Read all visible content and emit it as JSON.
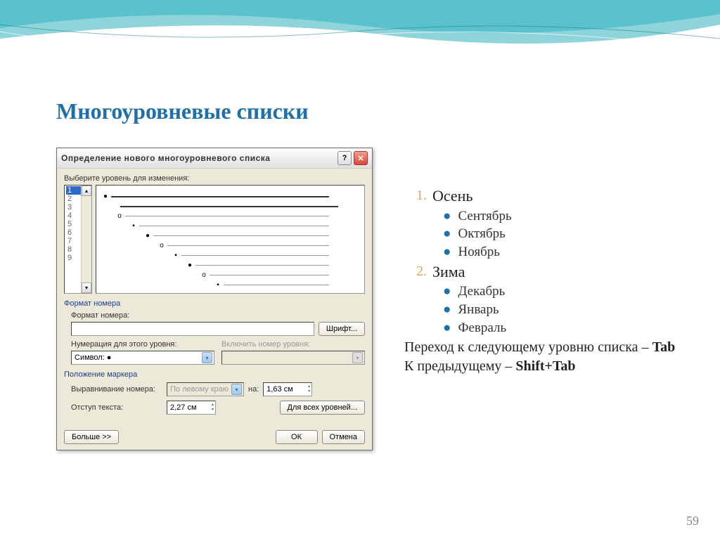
{
  "slide": {
    "title": "Многоуровневые списки",
    "page_number": "59"
  },
  "dialog": {
    "title": "Определение нового многоуровневого списка",
    "level_label": "Выберите уровень для изменения:",
    "levels": [
      "1",
      "2",
      "3",
      "4",
      "5",
      "6",
      "7",
      "8",
      "9"
    ],
    "format_section": "Формат номера",
    "format_label": "Формат номера:",
    "format_value": "",
    "font_btn": "Шрифт...",
    "numbering_label": "Нумерация для этого уровня:",
    "numbering_value": "Символ: ●",
    "include_label": "Включить номер уровня:",
    "include_value": "",
    "position_section": "Положение маркера",
    "align_label": "Выравнивание номера:",
    "align_value": "По левому краю",
    "at_label": "на:",
    "at_value": "1,63 см",
    "indent_label": "Отступ текста:",
    "indent_value": "2,27 см",
    "all_levels_btn": "Для всех уровней...",
    "more_btn": "Больше >>",
    "ok_btn": "ОК",
    "cancel_btn": "Отмена"
  },
  "example": {
    "item1_num": "1.",
    "item1_text": "Осень",
    "sub1_1": "Сентябрь",
    "sub1_2": "Октябрь",
    "sub1_3": "Ноябрь",
    "item2_num": "2.",
    "item2_text": "Зима",
    "sub2_1": "Декабрь",
    "sub2_2": "Январь",
    "sub2_3": "Февраль",
    "note1_a": "Переход к следующему уровню списка – ",
    "note1_b": "Tab",
    "note2_a": "К предыдущему – ",
    "note2_b": "Shift+Tab"
  }
}
